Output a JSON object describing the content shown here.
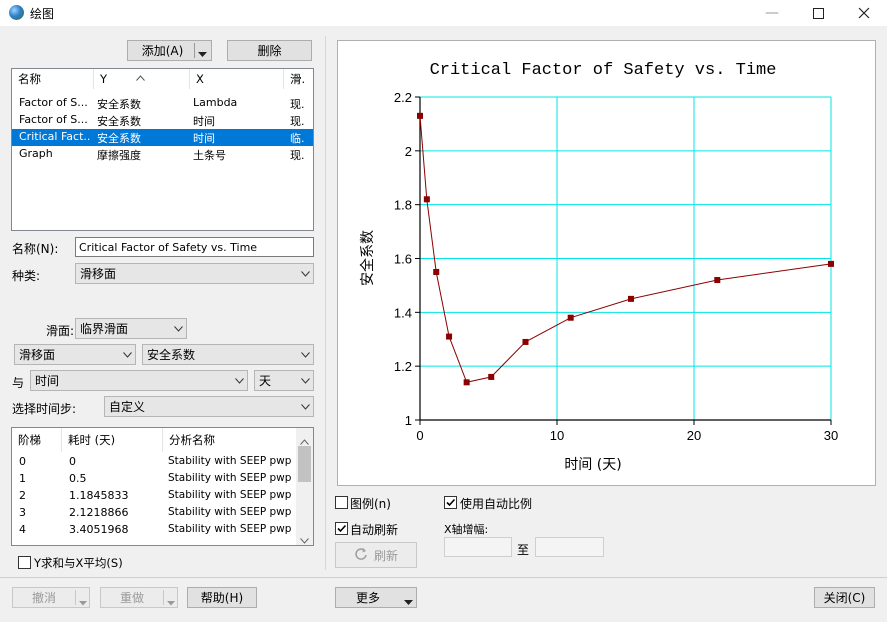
{
  "window": {
    "title": "绘图"
  },
  "toolbar": {
    "add_label": "添加(A)",
    "delete_label": "删除"
  },
  "graph_list": {
    "columns": [
      "名称",
      "Y",
      "X",
      "滑."
    ],
    "rows": [
      {
        "name": "Factor of S...",
        "y": "安全系数",
        "x": "Lambda",
        "slip": "现."
      },
      {
        "name": "Factor of S...",
        "y": "安全系数",
        "x": "时间",
        "slip": "现."
      },
      {
        "name": "Critical Fact...",
        "y": "安全系数",
        "x": "时间",
        "slip": "临."
      },
      {
        "name": "Graph",
        "y": "摩擦强度",
        "x": "土条号",
        "slip": "现."
      }
    ]
  },
  "form": {
    "name_label": "名称(N):",
    "name_value": "Critical Factor of Safety vs. Time",
    "type_label": "种类:",
    "type_value": "滑移面",
    "slip_label": "滑面:",
    "slip_value": "临界滑面",
    "y_source": "滑移面",
    "y_value": "安全系数",
    "with_label": "与",
    "x_value": "时间",
    "x_unit": "天",
    "timestep_label": "选择时间步:",
    "timestep_value": "自定义"
  },
  "step_list": {
    "columns": [
      "阶梯",
      "耗时 (天)",
      "分析名称"
    ],
    "rows": [
      {
        "step": "0",
        "time": "0",
        "analysis": "Stability with SEEP pwp"
      },
      {
        "step": "1",
        "time": "0.5",
        "analysis": "Stability with SEEP pwp"
      },
      {
        "step": "2",
        "time": "1.1845833",
        "analysis": "Stability with SEEP pwp"
      },
      {
        "step": "3",
        "time": "2.1218866",
        "analysis": "Stability with SEEP pwp"
      },
      {
        "step": "4",
        "time": "3.4051968",
        "analysis": "Stability with SEEP pwp"
      }
    ]
  },
  "options": {
    "y_sum_label": "Y求和与X平均(S)",
    "legend_label": "图例(n)",
    "auto_refresh_label": "自动刷新",
    "auto_scale_label": "使用自动比例",
    "refresh_label": "刷新",
    "x_increment_label": "X轴增幅:",
    "to_label": "至"
  },
  "bottom": {
    "undo_label": "撤消",
    "redo_label": "重做",
    "help_label": "帮助(H)",
    "more_label": "更多",
    "close_label": "关闭(C)"
  },
  "colors": {
    "selection": "#0078d7",
    "grid": "#00e5e5",
    "series": "#8b0000"
  },
  "chart_data": {
    "type": "line",
    "title": "Critical Factor of Safety vs. Time",
    "xlabel": "时间 (天)",
    "ylabel": "安全系数",
    "xlim": [
      0,
      30
    ],
    "ylim": [
      1,
      2.2
    ],
    "x_ticks": [
      0,
      10,
      20,
      30
    ],
    "y_ticks": [
      "1",
      "1.2",
      "1.4",
      "1.6",
      "1.8",
      "2",
      "2.2"
    ],
    "grid": true,
    "series": [
      {
        "x": [
          0,
          0.5,
          1.1845833,
          2.1218866,
          3.4051968,
          5.2,
          7.7,
          11,
          15.4,
          21.7,
          30
        ],
        "y": [
          2.13,
          1.82,
          1.55,
          1.31,
          1.14,
          1.16,
          1.29,
          1.38,
          1.45,
          1.52,
          1.58
        ]
      }
    ]
  }
}
